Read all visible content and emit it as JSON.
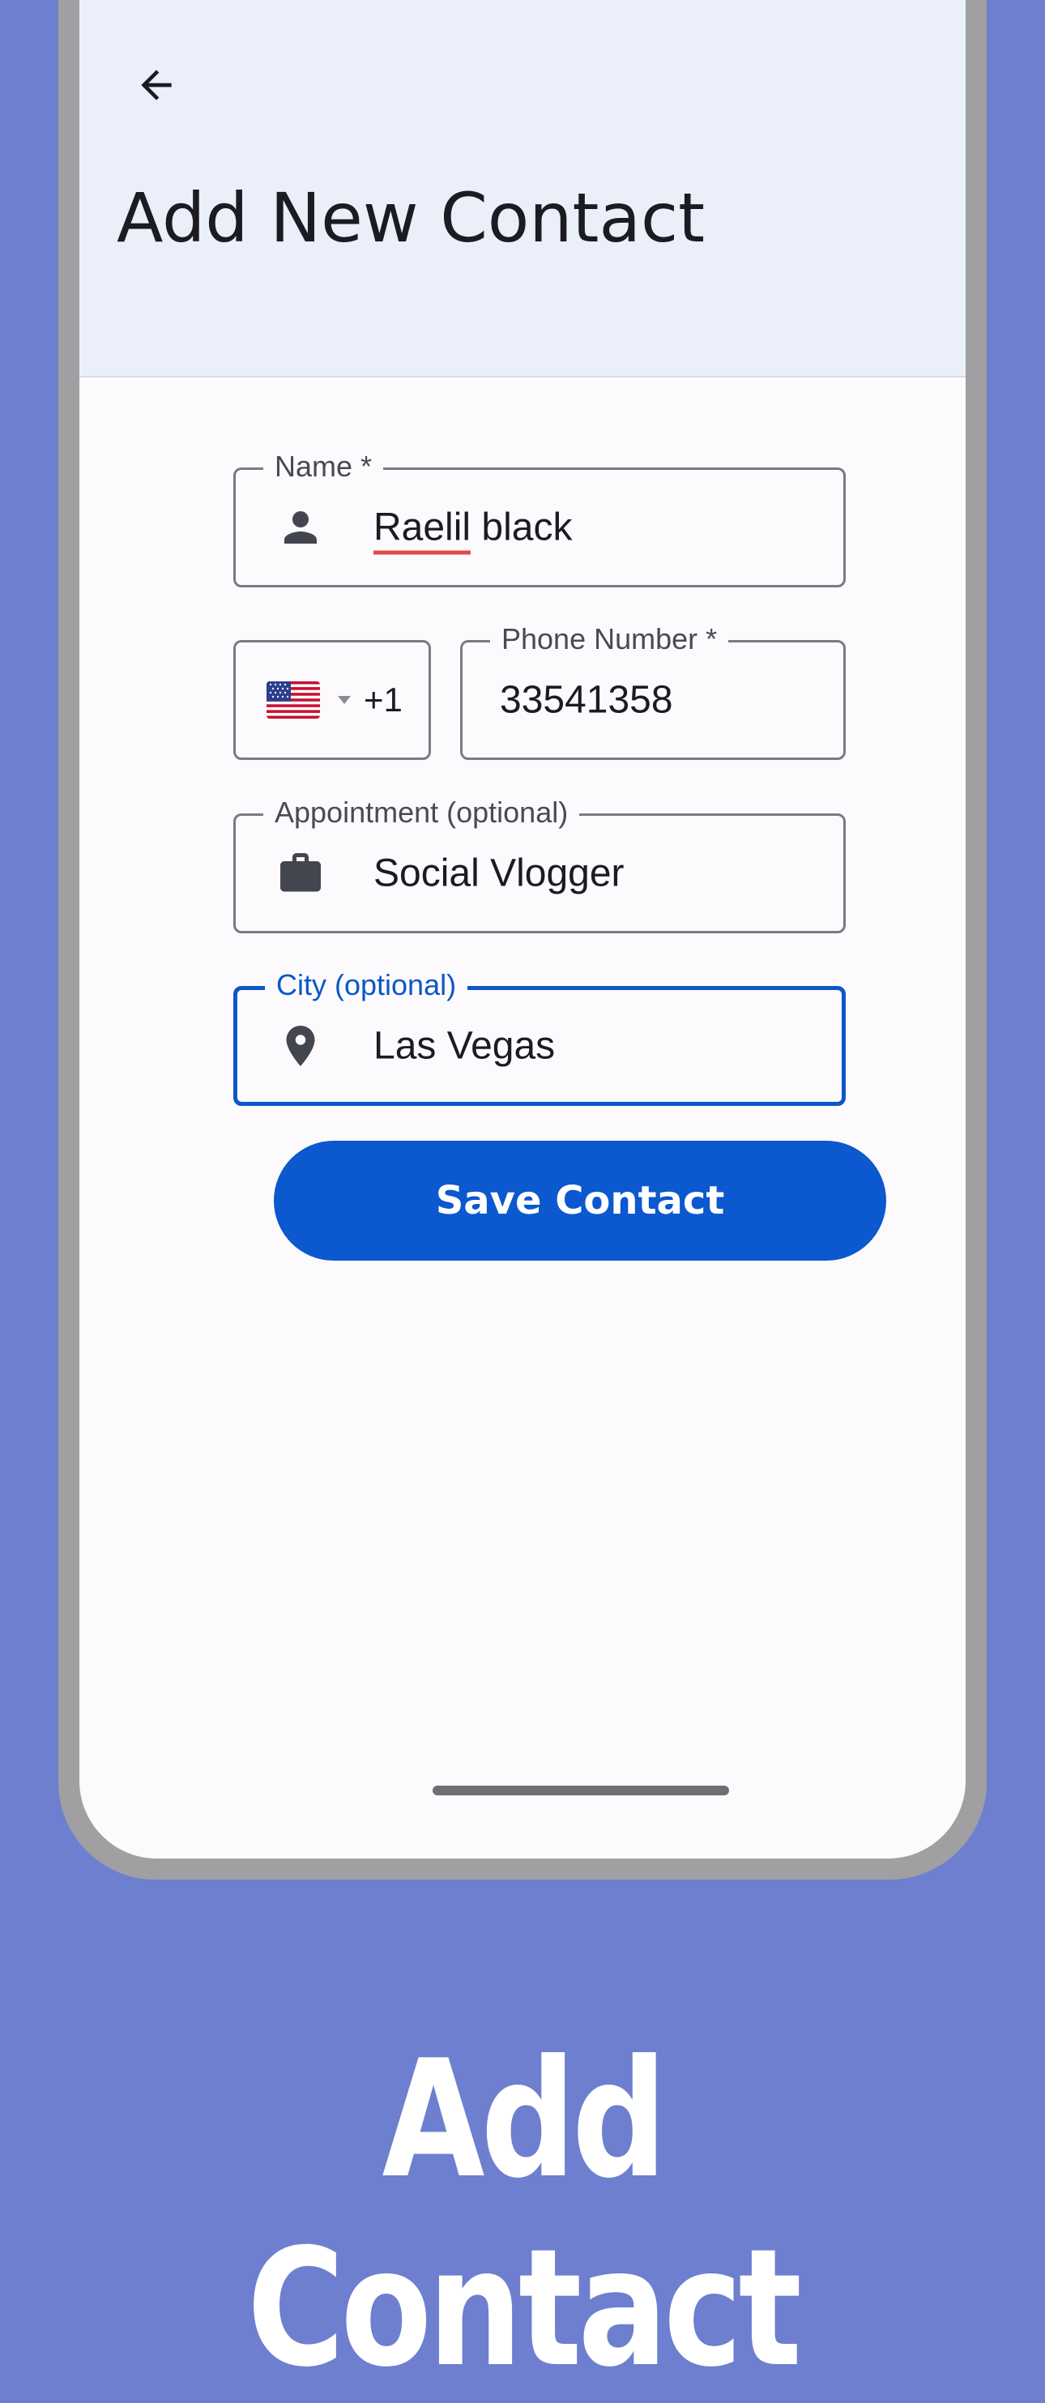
{
  "screen": {
    "title": "Add New Contact"
  },
  "form": {
    "name": {
      "label": "Name *",
      "value_misspelled": "Raelil",
      "value_rest": " black"
    },
    "country": {
      "dial_code": "+1",
      "flag": "us-flag-icon"
    },
    "phone": {
      "label": "Phone Number *",
      "value": "33541358"
    },
    "appointment": {
      "label": "Appointment (optional)",
      "value": "Social Vlogger"
    },
    "city": {
      "label": "City (optional)",
      "value": "Las Vegas"
    },
    "save_label": "Save Contact"
  },
  "caption": "Add Contact",
  "colors": {
    "background": "#6e7fcf",
    "primary": "#0b58cf",
    "appbar": "#eaeffa"
  }
}
